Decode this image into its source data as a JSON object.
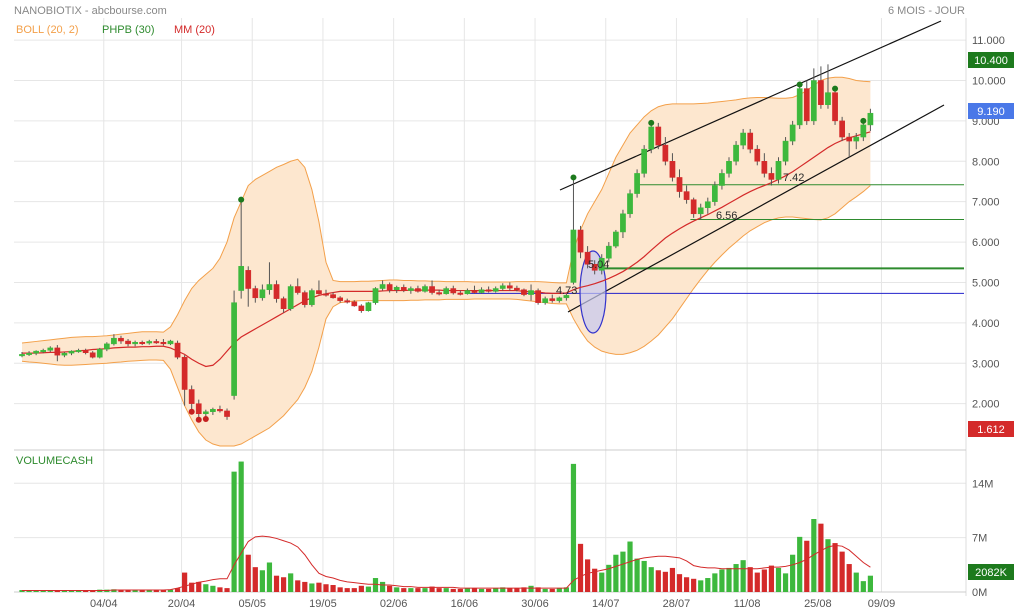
{
  "header": {
    "title": "NANOBIOTIX - abcbourse.com",
    "period": "6 MOIS - JOUR"
  },
  "legend": {
    "boll": "BOLL (20, 2)",
    "phpb": "PHPB (30)",
    "mm": "MM (20)",
    "volume": "VOLUMECASH"
  },
  "colors": {
    "up": "#3db83d",
    "down": "#d42a2a",
    "boll_fill": "#fde7cf",
    "boll_line": "#f3a04a",
    "mm": "#d42a2a",
    "trend": "#111111",
    "support": "#2e8b2e",
    "blue_line": "#2222cc",
    "ellipse_fill": "#c5c8f0",
    "ellipse_stroke": "#3333cc",
    "grid": "#e6e6e6",
    "label_last": "#4a78e8",
    "label_high": "#1d7a1d",
    "label_low": "#d42a2a",
    "label_vol": "#1d7a1d"
  },
  "badges": {
    "high": "10.400",
    "last": "9.190",
    "low": "1.612",
    "volume": "2082K"
  },
  "chart_data": [
    {
      "type": "candlestick",
      "title": "NANOBIOTIX",
      "period": "6 MOIS - JOUR",
      "y_ticks": [
        "2.000",
        "3.000",
        "4.000",
        "5.000",
        "6.000",
        "7.000",
        "8.000",
        "9.000",
        "10.000",
        "11.000"
      ],
      "ylim": [
        1.1,
        11.25
      ],
      "x_labels": [
        "04/04",
        "20/04",
        "05/05",
        "19/05",
        "02/06",
        "16/06",
        "30/06",
        "14/07",
        "28/07",
        "11/08",
        "25/08",
        "09/09"
      ],
      "annotations": [
        "5.04",
        "4.73",
        "6.56",
        "7.42"
      ],
      "horizontal_levels": [
        7.42,
        6.56,
        5.35,
        4.73
      ],
      "candles": [
        [
          3.2,
          3.28,
          3.15,
          3.22
        ],
        [
          3.22,
          3.3,
          3.18,
          3.25
        ],
        [
          3.25,
          3.32,
          3.2,
          3.3
        ],
        [
          3.3,
          3.36,
          3.25,
          3.32
        ],
        [
          3.32,
          3.42,
          3.28,
          3.38
        ],
        [
          3.38,
          3.45,
          3.05,
          3.2
        ],
        [
          3.2,
          3.28,
          3.15,
          3.25
        ],
        [
          3.25,
          3.32,
          3.2,
          3.3
        ],
        [
          3.3,
          3.36,
          3.26,
          3.32
        ],
        [
          3.32,
          3.36,
          3.22,
          3.26
        ],
        [
          3.26,
          3.3,
          3.12,
          3.15
        ],
        [
          3.15,
          3.38,
          3.12,
          3.35
        ],
        [
          3.35,
          3.52,
          3.3,
          3.48
        ],
        [
          3.48,
          3.72,
          3.44,
          3.62
        ],
        [
          3.62,
          3.68,
          3.48,
          3.55
        ],
        [
          3.55,
          3.6,
          3.42,
          3.48
        ],
        [
          3.48,
          3.56,
          3.42,
          3.52
        ],
        [
          3.52,
          3.56,
          3.45,
          3.5
        ],
        [
          3.5,
          3.58,
          3.46,
          3.54
        ],
        [
          3.54,
          3.6,
          3.48,
          3.52
        ],
        [
          3.52,
          3.6,
          3.44,
          3.48
        ],
        [
          3.48,
          3.58,
          3.45,
          3.55
        ],
        [
          3.5,
          3.56,
          3.1,
          3.15
        ],
        [
          3.15,
          3.2,
          1.95,
          2.35
        ],
        [
          2.35,
          2.45,
          1.8,
          2.0
        ],
        [
          2.0,
          2.1,
          1.6,
          1.75
        ],
        [
          1.75,
          1.85,
          1.62,
          1.8
        ],
        [
          1.8,
          1.9,
          1.72,
          1.86
        ],
        [
          1.86,
          1.95,
          1.78,
          1.82
        ],
        [
          1.82,
          1.88,
          1.6,
          1.68
        ],
        [
          2.2,
          4.8,
          2.1,
          4.5
        ],
        [
          4.8,
          7.05,
          4.6,
          5.4
        ],
        [
          5.3,
          5.4,
          4.4,
          4.85
        ],
        [
          4.85,
          4.92,
          4.5,
          4.62
        ],
        [
          4.62,
          4.95,
          4.55,
          4.82
        ],
        [
          4.82,
          5.5,
          4.7,
          4.95
        ],
        [
          4.95,
          5.05,
          4.5,
          4.6
        ],
        [
          4.6,
          4.65,
          4.25,
          4.35
        ],
        [
          4.35,
          4.95,
          4.3,
          4.9
        ],
        [
          4.9,
          5.1,
          4.7,
          4.75
        ],
        [
          4.75,
          4.8,
          4.38,
          4.45
        ],
        [
          4.45,
          4.85,
          4.4,
          4.8
        ],
        [
          4.8,
          5.05,
          4.7,
          4.72
        ],
        [
          4.72,
          4.82,
          4.65,
          4.7
        ],
        [
          4.7,
          4.75,
          4.6,
          4.62
        ],
        [
          4.62,
          4.66,
          4.5,
          4.55
        ],
        [
          4.55,
          4.6,
          4.48,
          4.52
        ],
        [
          4.52,
          4.56,
          4.4,
          4.42
        ],
        [
          4.42,
          4.46,
          4.25,
          4.3
        ],
        [
          4.3,
          4.52,
          4.28,
          4.5
        ],
        [
          4.5,
          4.88,
          4.45,
          4.85
        ],
        [
          4.85,
          5.05,
          4.8,
          4.95
        ],
        [
          4.95,
          5.0,
          4.75,
          4.82
        ],
        [
          4.82,
          4.92,
          4.74,
          4.88
        ],
        [
          4.88,
          4.95,
          4.76,
          4.8
        ],
        [
          4.8,
          4.9,
          4.72,
          4.85
        ],
        [
          4.85,
          4.92,
          4.75,
          4.78
        ],
        [
          4.78,
          4.95,
          4.75,
          4.9
        ],
        [
          4.9,
          5.05,
          4.7,
          4.75
        ],
        [
          4.75,
          4.82,
          4.68,
          4.72
        ],
        [
          4.72,
          4.9,
          4.7,
          4.85
        ],
        [
          4.85,
          4.92,
          4.7,
          4.74
        ],
        [
          4.74,
          4.8,
          4.68,
          4.72
        ],
        [
          4.72,
          4.85,
          4.7,
          4.8
        ],
        [
          4.8,
          4.92,
          4.72,
          4.75
        ],
        [
          4.75,
          4.88,
          4.72,
          4.82
        ],
        [
          4.82,
          4.9,
          4.75,
          4.78
        ],
        [
          4.78,
          4.9,
          4.75,
          4.85
        ],
        [
          4.85,
          4.98,
          4.8,
          4.92
        ],
        [
          4.92,
          5.0,
          4.8,
          4.86
        ],
        [
          4.86,
          4.92,
          4.78,
          4.82
        ],
        [
          4.82,
          4.85,
          4.66,
          4.7
        ],
        [
          4.7,
          4.95,
          4.55,
          4.8
        ],
        [
          4.8,
          4.85,
          4.45,
          4.5
        ],
        [
          4.5,
          4.65,
          4.45,
          4.6
        ],
        [
          4.6,
          4.7,
          4.5,
          4.55
        ],
        [
          4.55,
          4.65,
          4.5,
          4.62
        ],
        [
          4.62,
          4.72,
          4.55,
          4.68
        ],
        [
          5.0,
          7.6,
          4.95,
          6.3
        ],
        [
          6.3,
          6.4,
          5.6,
          5.75
        ],
        [
          5.75,
          5.9,
          5.35,
          5.45
        ],
        [
          5.45,
          5.55,
          5.2,
          5.3
        ],
        [
          5.3,
          5.7,
          5.2,
          5.6
        ],
        [
          5.6,
          6.0,
          5.5,
          5.9
        ],
        [
          5.9,
          6.3,
          5.85,
          6.25
        ],
        [
          6.25,
          6.8,
          6.1,
          6.7
        ],
        [
          6.7,
          7.3,
          6.6,
          7.2
        ],
        [
          7.2,
          7.8,
          7.1,
          7.7
        ],
        [
          7.7,
          8.4,
          7.6,
          8.3
        ],
        [
          8.3,
          8.95,
          8.2,
          8.85
        ],
        [
          8.85,
          8.95,
          8.3,
          8.4
        ],
        [
          8.4,
          8.6,
          7.9,
          8.0
        ],
        [
          8.0,
          8.2,
          7.5,
          7.6
        ],
        [
          7.6,
          7.8,
          7.1,
          7.25
        ],
        [
          7.25,
          7.4,
          6.95,
          7.05
        ],
        [
          7.05,
          7.1,
          6.6,
          6.7
        ],
        [
          6.7,
          6.95,
          6.55,
          6.85
        ],
        [
          6.85,
          7.1,
          6.7,
          7.0
        ],
        [
          7.0,
          7.5,
          6.9,
          7.4
        ],
        [
          7.4,
          7.8,
          7.3,
          7.7
        ],
        [
          7.7,
          8.1,
          7.6,
          8.0
        ],
        [
          8.0,
          8.5,
          7.9,
          8.4
        ],
        [
          8.4,
          8.8,
          8.3,
          8.7
        ],
        [
          8.7,
          8.8,
          8.2,
          8.3
        ],
        [
          8.3,
          8.4,
          7.9,
          8.0
        ],
        [
          8.0,
          8.2,
          7.6,
          7.7
        ],
        [
          7.7,
          7.85,
          7.4,
          7.55
        ],
        [
          7.55,
          8.1,
          7.45,
          8.0
        ],
        [
          8.0,
          8.6,
          7.9,
          8.5
        ],
        [
          8.5,
          9.0,
          8.4,
          8.9
        ],
        [
          8.9,
          9.9,
          8.8,
          9.8
        ],
        [
          9.8,
          10.0,
          8.9,
          9.0
        ],
        [
          9.0,
          10.3,
          8.9,
          10.0
        ],
        [
          10.0,
          10.35,
          9.3,
          9.4
        ],
        [
          9.4,
          10.4,
          9.3,
          9.7
        ],
        [
          9.7,
          9.8,
          8.9,
          9.0
        ],
        [
          9.0,
          9.1,
          8.5,
          8.6
        ],
        [
          8.6,
          8.7,
          8.1,
          8.5
        ],
        [
          8.5,
          8.7,
          8.3,
          8.6
        ],
        [
          8.6,
          9.0,
          8.5,
          8.9
        ],
        [
          8.9,
          9.3,
          8.75,
          9.19
        ]
      ],
      "mm20": [
        3.25,
        3.25,
        3.25,
        3.26,
        3.27,
        3.27,
        3.28,
        3.29,
        3.31,
        3.32,
        3.34,
        3.35,
        3.36,
        3.38,
        3.39,
        3.4,
        3.4,
        3.41,
        3.41,
        3.42,
        3.42,
        3.38,
        3.3,
        3.22,
        3.1,
        3.0,
        2.92,
        2.95,
        3.1,
        3.3,
        3.5,
        3.65,
        3.75,
        3.85,
        3.95,
        4.05,
        4.15,
        4.25,
        4.35,
        4.45,
        4.55,
        4.62,
        4.68,
        4.72,
        4.75,
        4.78,
        4.78,
        4.78,
        4.78,
        4.78,
        4.78,
        4.79,
        4.8,
        4.8,
        4.8,
        4.81,
        4.81,
        4.81,
        4.81,
        4.81,
        4.8,
        4.8,
        4.8,
        4.8,
        4.8,
        4.8,
        4.8,
        4.8,
        4.8,
        4.8,
        4.8,
        4.78,
        4.77,
        4.76,
        4.74,
        4.73,
        4.73,
        4.74,
        4.82,
        4.88,
        4.92,
        4.97,
        5.03,
        5.1,
        5.18,
        5.27,
        5.38,
        5.5,
        5.64,
        5.8,
        5.95,
        6.1,
        6.22,
        6.33,
        6.43,
        6.52,
        6.6,
        6.68,
        6.77,
        6.86,
        6.96,
        7.06,
        7.16,
        7.25,
        7.33,
        7.4,
        7.47,
        7.55,
        7.64,
        7.74,
        7.86,
        7.98,
        8.1,
        8.22,
        8.34,
        8.44,
        8.52,
        8.58,
        8.63,
        8.68,
        8.73
      ],
      "boll_upper": [
        3.5,
        3.52,
        3.54,
        3.56,
        3.58,
        3.6,
        3.62,
        3.64,
        3.65,
        3.66,
        3.66,
        3.67,
        3.68,
        3.7,
        3.72,
        3.74,
        3.76,
        3.78,
        3.78,
        3.78,
        3.77,
        3.9,
        4.2,
        4.55,
        4.85,
        5.05,
        5.2,
        5.35,
        5.6,
        6.0,
        6.6,
        7.0,
        7.4,
        7.55,
        7.65,
        7.75,
        7.85,
        7.92,
        8.0,
        8.05,
        7.85,
        7.3,
        6.5,
        5.5,
        5.05,
        5.02,
        5.02,
        5.02,
        5.03,
        5.03,
        5.04,
        5.05,
        5.06,
        5.06,
        5.05,
        5.05,
        5.04,
        5.04,
        5.03,
        5.03,
        5.02,
        5.02,
        5.02,
        5.02,
        5.01,
        5.01,
        5.01,
        5.01,
        5.01,
        5.01,
        5.02,
        5.02,
        5.02,
        5.02,
        5.01,
        5.0,
        4.99,
        4.99,
        5.8,
        6.3,
        6.7,
        7.0,
        7.3,
        7.7,
        8.1,
        8.4,
        8.7,
        8.9,
        9.1,
        9.25,
        9.35,
        9.4,
        9.42,
        9.42,
        9.42,
        9.42,
        9.43,
        9.44,
        9.46,
        9.48,
        9.5,
        9.52,
        9.55,
        9.57,
        9.58,
        9.58,
        9.57,
        9.56,
        9.56,
        9.58,
        9.65,
        9.75,
        9.88,
        10.0,
        10.06,
        10.08,
        10.08,
        10.05,
        10.0,
        9.98,
        9.97
      ],
      "boll_lower": [
        3.05,
        3.03,
        3.02,
        3.0,
        2.98,
        2.96,
        2.95,
        2.95,
        2.96,
        2.97,
        2.98,
        2.99,
        3.0,
        3.02,
        3.03,
        3.05,
        3.06,
        3.07,
        3.08,
        3.08,
        3.07,
        2.85,
        2.4,
        1.95,
        1.6,
        1.3,
        1.1,
        1.0,
        0.9,
        0.9,
        0.95,
        1.0,
        1.1,
        1.2,
        1.3,
        1.4,
        1.55,
        1.7,
        1.9,
        2.1,
        2.4,
        2.8,
        3.4,
        4.1,
        4.4,
        4.5,
        4.52,
        4.54,
        4.55,
        4.55,
        4.55,
        4.55,
        4.55,
        4.55,
        4.55,
        4.56,
        4.56,
        4.57,
        4.57,
        4.57,
        4.58,
        4.58,
        4.58,
        4.58,
        4.59,
        4.59,
        4.59,
        4.59,
        4.59,
        4.59,
        4.58,
        4.56,
        4.54,
        4.52,
        4.5,
        4.48,
        4.47,
        4.47,
        4.1,
        3.8,
        3.55,
        3.4,
        3.3,
        3.25,
        3.22,
        3.22,
        3.26,
        3.32,
        3.42,
        3.55,
        3.7,
        3.9,
        4.1,
        4.35,
        4.6,
        4.85,
        5.08,
        5.3,
        5.5,
        5.68,
        5.85,
        6.0,
        6.15,
        6.28,
        6.38,
        6.48,
        6.55,
        6.6,
        6.62,
        6.62,
        6.6,
        6.58,
        6.56,
        6.55,
        6.6,
        6.7,
        6.85,
        7.0,
        7.12,
        7.25,
        7.4
      ]
    },
    {
      "type": "bar",
      "title": "VOLUMECASH",
      "y_ticks": [
        "0M",
        "7M",
        "14M"
      ],
      "ylim": [
        0,
        17
      ],
      "last_value": "2082K",
      "volumes": [
        0.25,
        0.2,
        0.2,
        0.15,
        0.2,
        0.25,
        0.2,
        0.15,
        0.2,
        0.2,
        0.25,
        0.3,
        0.3,
        0.35,
        0.25,
        0.2,
        0.2,
        0.2,
        0.2,
        0.2,
        0.25,
        0.3,
        0.5,
        2.5,
        1.2,
        1.3,
        1.0,
        0.8,
        0.6,
        0.5,
        15.5,
        16.8,
        4.8,
        3.2,
        2.8,
        3.8,
        2.1,
        1.9,
        2.4,
        1.5,
        1.3,
        1.1,
        1.2,
        1.0,
        0.9,
        0.6,
        0.5,
        0.5,
        0.8,
        0.7,
        1.8,
        1.3,
        0.8,
        0.6,
        0.5,
        0.5,
        0.5,
        0.5,
        0.7,
        0.5,
        0.5,
        0.4,
        0.4,
        0.5,
        0.5,
        0.4,
        0.4,
        0.5,
        0.6,
        0.5,
        0.5,
        0.6,
        0.8,
        0.6,
        0.4,
        0.4,
        0.5,
        0.6,
        16.5,
        6.2,
        4.2,
        3.0,
        2.5,
        3.5,
        4.8,
        5.2,
        6.5,
        4.3,
        4.0,
        3.2,
        2.8,
        2.6,
        3.1,
        2.3,
        1.9,
        1.7,
        1.5,
        1.8,
        2.4,
        2.9,
        3.1,
        3.6,
        4.1,
        3.2,
        2.5,
        2.9,
        3.4,
        3.1,
        2.4,
        4.8,
        7.1,
        6.6,
        9.4,
        8.8,
        6.8,
        6.3,
        5.2,
        3.6,
        2.5,
        1.4,
        2.1
      ],
      "volume_avg": [
        0.2,
        0.2,
        0.2,
        0.2,
        0.2,
        0.2,
        0.2,
        0.2,
        0.2,
        0.2,
        0.2,
        0.2,
        0.2,
        0.25,
        0.25,
        0.25,
        0.25,
        0.25,
        0.25,
        0.25,
        0.25,
        0.3,
        0.5,
        0.75,
        1.0,
        1.25,
        1.4,
        1.6,
        1.7,
        1.7,
        3.5,
        5.0,
        6.5,
        7.1,
        7.2,
        7.1,
        6.9,
        6.6,
        6.3,
        5.8,
        4.8,
        3.5,
        2.4,
        2.0,
        1.8,
        1.5,
        1.3,
        1.2,
        1.1,
        1.0,
        1.0,
        0.9,
        0.9,
        0.8,
        0.7,
        0.7,
        0.6,
        0.6,
        0.6,
        0.6,
        0.6,
        0.6,
        0.5,
        0.5,
        0.5,
        0.5,
        0.5,
        0.5,
        0.5,
        0.5,
        0.5,
        0.5,
        0.5,
        0.5,
        0.5,
        0.5,
        0.5,
        0.5,
        1.5,
        2.0,
        2.4,
        2.6,
        2.8,
        3.0,
        3.3,
        3.6,
        3.9,
        4.2,
        4.4,
        4.5,
        4.6,
        4.6,
        4.5,
        4.4,
        4.0,
        3.4,
        3.2,
        3.1,
        3.1,
        3.0,
        3.0,
        3.0,
        3.0,
        3.0,
        3.0,
        3.1,
        3.2,
        3.2,
        3.3,
        3.5,
        3.8,
        4.2,
        4.8,
        5.3,
        5.8,
        6.0,
        5.9,
        5.4,
        4.6,
        3.8,
        3.2
      ]
    }
  ]
}
